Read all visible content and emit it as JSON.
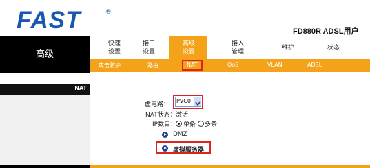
{
  "brand": {
    "logo": "FAST",
    "trademark": "®",
    "model": "FD880R ADSL用户"
  },
  "sidebar": {
    "title": "高级"
  },
  "menu": [
    {
      "line1": "快速",
      "line2": "设置"
    },
    {
      "line1": "接口",
      "line2": "设置"
    },
    {
      "line1": "高级",
      "line2": "设置",
      "active": true
    },
    {
      "line1": "接入",
      "line2": "管理"
    },
    {
      "line1": "维护",
      "line2": ""
    },
    {
      "line1": "状态",
      "line2": ""
    }
  ],
  "submenu": [
    "攻击防护",
    "路由",
    "NAT",
    "QoS",
    "VLAN",
    "ADSL"
  ],
  "section": {
    "label": "NAT"
  },
  "form": {
    "vc_label": "虚电路：",
    "vc_value": "PVC0",
    "nat_status_label": "NAT状态：",
    "nat_status_value": "激活",
    "ip_count_label": "IP数目：",
    "option_single": "单条",
    "option_multiple": "多条"
  },
  "links": {
    "dmz": "DMZ",
    "virtual_server": "虚拟服务器"
  },
  "colors": {
    "brand_blue": "#1a57b0",
    "accent_orange": "#f4a21a",
    "highlight_red": "#dd2222"
  }
}
